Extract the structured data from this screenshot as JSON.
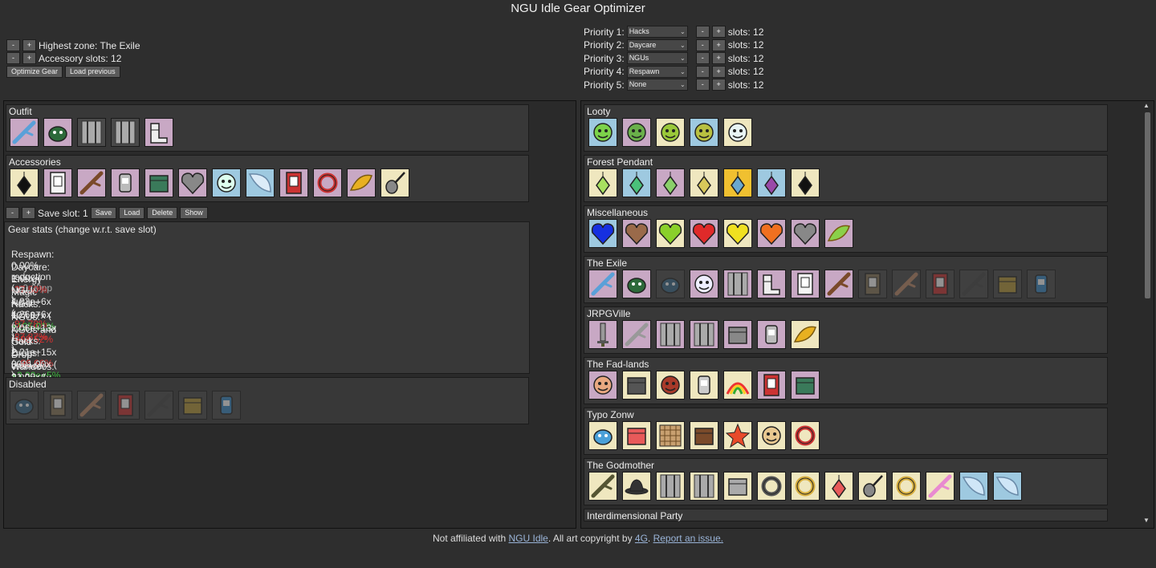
{
  "title": "NGU Idle Gear Optimizer",
  "controls": {
    "minus": "-",
    "plus": "+",
    "highest_zone_label": "Highest zone: The Exile",
    "accessory_slots_label": "Accessory slots: 12",
    "optimize_button": "Optimize Gear",
    "load_previous_button": "Load previous"
  },
  "priorities": [
    {
      "label": "Priority 1:",
      "value": "Hacks",
      "slots": "slots: 12"
    },
    {
      "label": "Priority 2:",
      "value": "Daycare",
      "slots": "slots: 12"
    },
    {
      "label": "Priority 3:",
      "value": "NGUs",
      "slots": "slots: 12"
    },
    {
      "label": "Priority 4:",
      "value": "Respawn",
      "slots": "slots: 12"
    },
    {
      "label": "Priority 5:",
      "value": "None",
      "slots": "slots: 12"
    }
  ],
  "dropdown_arrow": "⌄",
  "left": {
    "outfit_title": "Outfit",
    "accessories_title": "Accessories",
    "disabled_title": "Disabled",
    "save": {
      "label": "Save slot: 1",
      "save_button": "Save",
      "load_button": "Load",
      "delete_button": "Delete",
      "show_button": "Show"
    },
    "stats_title": "Gear stats (change w.r.t. save slot)",
    "stats": [
      {
        "label": "Respawn: 0.00% reduction (",
        "delta": "+0.00pp",
        "tone": "muted",
        "close": ")"
      },
      {
        "label": "Daycare: 1.00x (",
        "delta": "-37.50%",
        "tone": "neg",
        "close": ")"
      },
      {
        "label": "Energy NGU: 4.83e+6x (",
        "delta": "-87.78%",
        "tone": "neg",
        "close": ")"
      },
      {
        "label": "Magic NGU: 4.26e+6x (",
        "delta": "-87.87%",
        "tone": "neg",
        "close": ")"
      },
      {
        "label": "Hacks: 107.37x (",
        "delta": "+125.01%",
        "tone": "pos",
        "close": ")"
      },
      {
        "label": "NGUs: 2.06e+13x (",
        "delta": "-98.52%",
        "tone": "neg",
        "close": ")"
      },
      {
        "label": "NGUs and Hacks: 2.21e+15x (",
        "delta": "-96.66%",
        "tone": "neg",
        "close": ")"
      },
      {
        "label": "Gold Drops: 3001.00x (",
        "delta": "+3.00e+5%",
        "tone": "pos",
        "close": ")"
      },
      {
        "label": "Drop chance: 21.00x (",
        "delta": "+200.00%",
        "tone": "pos",
        "close": ")"
      },
      {
        "label": "Wandoos: 2.82e+5x (",
        "delta": "-65.78%",
        "tone": "neg",
        "close": ")"
      }
    ]
  },
  "right_groups": [
    {
      "title": "Looty"
    },
    {
      "title": "Forest Pendant"
    },
    {
      "title": "Miscellaneous"
    },
    {
      "title": "The Exile"
    },
    {
      "title": "JRPGVille"
    },
    {
      "title": "The Fad-lands"
    },
    {
      "title": "Typo Zonw"
    },
    {
      "title": "The Godmother"
    },
    {
      "title": "Interdimensional Party"
    }
  ],
  "scroll": {
    "up": "▲",
    "down": "▼"
  },
  "footer": {
    "prefix": "Not affiliated with ",
    "ngu_link": "NGU Idle",
    "mid": ". All art copyright by ",
    "author_link": "4G",
    "dot": ". ",
    "report_link": "Report an issue."
  },
  "colors": {
    "background": "#2e2e2e",
    "group": "#383838",
    "positive": "#3cba3c",
    "negative": "#d83232",
    "slot_pink": "#c8a8c4",
    "slot_cream": "#efe7bf",
    "slot_gray": "#4a4a4a"
  }
}
